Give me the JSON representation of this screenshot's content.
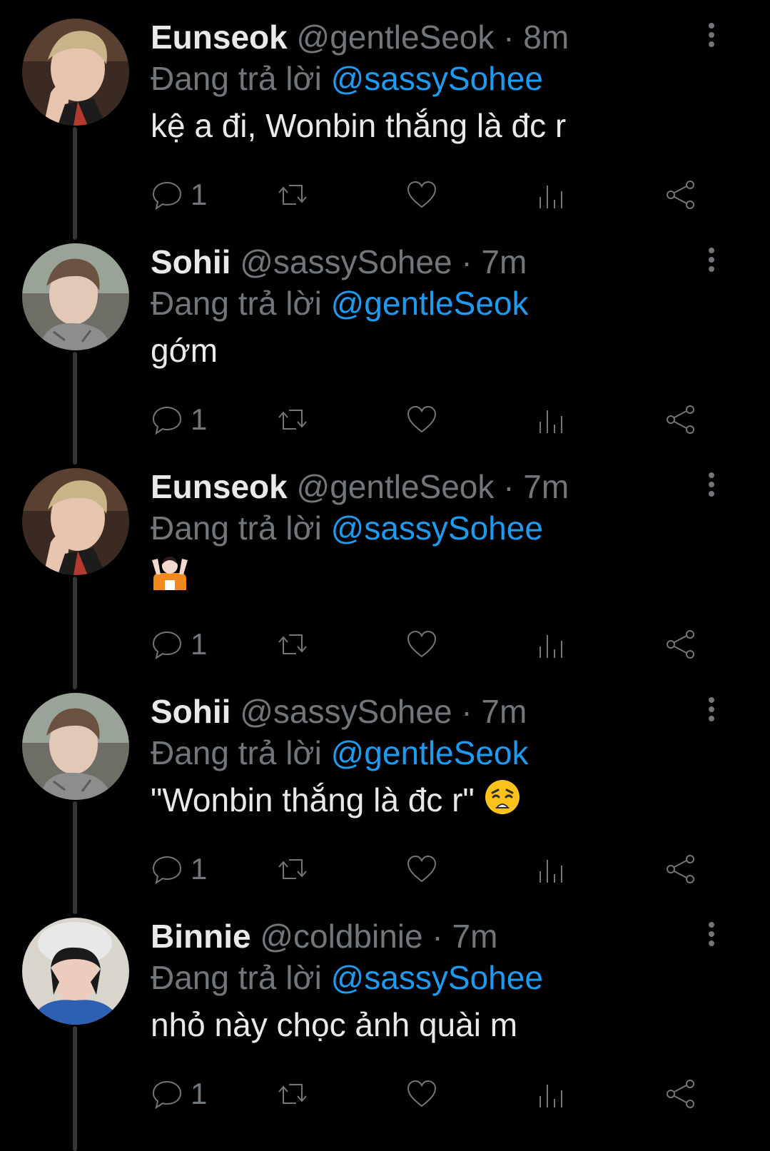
{
  "colors": {
    "background": "#000000",
    "primary_text": "#e7e9ea",
    "secondary_text": "#71767b",
    "mention": "#1d9bf0",
    "thread_line": "#333639"
  },
  "reply_prefix": "Đang trả lời",
  "tweets": [
    {
      "display_name": "Eunseok",
      "handle": "@gentleSeok",
      "separator": "·",
      "time": "8m",
      "reply_to": "@sassySohee",
      "text": "kệ a đi, Wonbin thắng là đc r",
      "reply_count": "1",
      "avatar": "eunseok"
    },
    {
      "display_name": "Sohii",
      "handle": "@sassySohee",
      "separator": "·",
      "time": "7m",
      "reply_to": "@gentleSeok",
      "text": "gớm",
      "reply_count": "1",
      "avatar": "sohee"
    },
    {
      "display_name": "Eunseok",
      "handle": "@gentleSeok",
      "separator": "·",
      "time": "7m",
      "reply_to": "@sassySohee",
      "text": "",
      "emoji": "person-shrugging-emoji",
      "reply_count": "1",
      "avatar": "eunseok"
    },
    {
      "display_name": "Sohii",
      "handle": "@sassySohee",
      "separator": "·",
      "time": "7m",
      "reply_to": "@gentleSeok",
      "text": "\"Wonbin thắng là đc r\"",
      "emoji": "weary-face-emoji",
      "reply_count": "1",
      "avatar": "sohee"
    },
    {
      "display_name": "Binnie",
      "handle": "@coldbinie",
      "separator": "·",
      "time": "7m",
      "reply_to": "@sassySohee",
      "text": "nhỏ này chọc ảnh quài m",
      "reply_count": "1",
      "avatar": "binnie"
    }
  ],
  "action_icons": [
    "reply-icon",
    "retweet-icon",
    "like-icon",
    "views-icon",
    "share-icon"
  ]
}
